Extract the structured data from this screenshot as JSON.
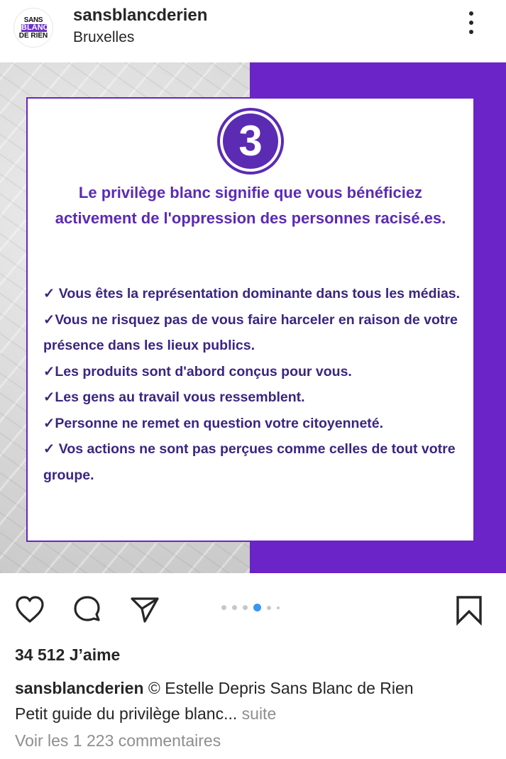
{
  "header": {
    "avatar_line1": "SANS",
    "avatar_line2": "BLANC",
    "avatar_line3": "DE RIEN",
    "username": "sansblancderien",
    "location": "Bruxelles",
    "more_icon": "more-vertical-icon"
  },
  "post": {
    "badge_number": "3",
    "headline": "Le privilège blanc signifie que vous bénéficiez activement de l'oppression des personnes racisé.es.",
    "items": [
      "✓ Vous êtes la représentation dominante dans tous les médias.",
      "✓Vous ne risquez pas de vous faire harceler en raison de votre présence dans les lieux publics.",
      "✓Les produits sont d'abord conçus pour vous.",
      "✓Les gens au travail vous ressemblent.",
      "✓Personne ne remet en question votre citoyenneté.",
      "✓ Vos actions ne sont pas perçues comme celles de tout votre groupe."
    ],
    "colors": {
      "purple": "#6a24c7",
      "text_purple": "#5b2bb3"
    }
  },
  "actions": {
    "like_icon": "heart-icon",
    "comment_icon": "comment-icon",
    "share_icon": "send-icon",
    "save_icon": "bookmark-icon",
    "carousel_total": 6,
    "carousel_active": 4
  },
  "likes": "34 512 J’aime",
  "caption": {
    "username": "sansblancderien",
    "text": " © Estelle Depris Sans Blanc de Rien",
    "line2": "Petit guide du privilège blanc",
    "ellipsis": "...",
    "more": " suite"
  },
  "comments_link": "Voir les 1 223 commentaires"
}
